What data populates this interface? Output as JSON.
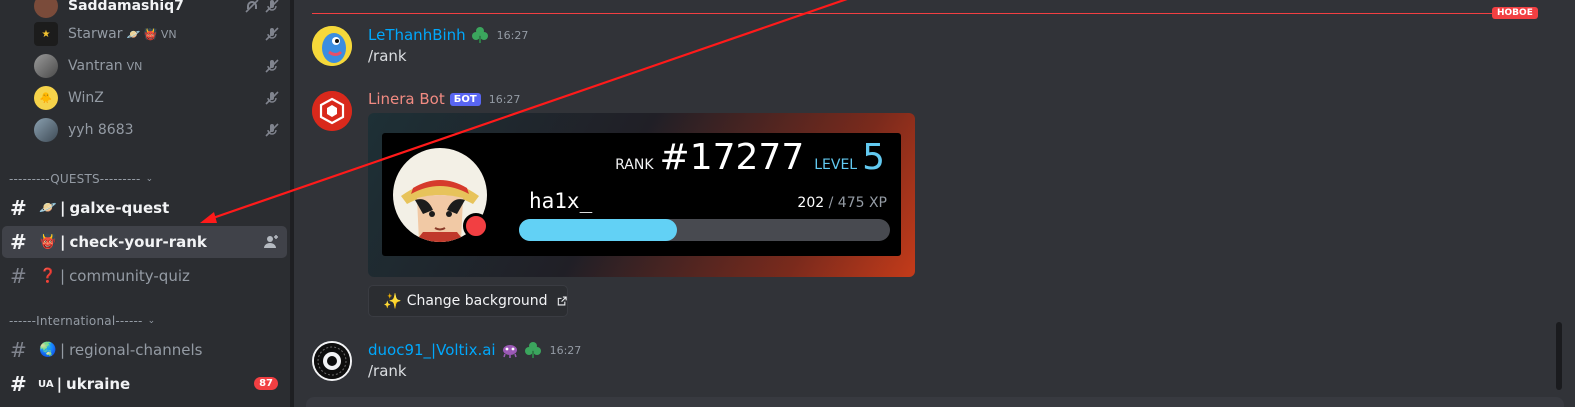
{
  "sidebar": {
    "members": [
      {
        "name": "Saddamashiq7",
        "deco": "",
        "bright": true
      },
      {
        "name": "Starwar",
        "deco": "🪐 👹 VN",
        "bright": false
      },
      {
        "name": "Vantran",
        "deco": "VN",
        "bright": false
      },
      {
        "name": "WinZ",
        "deco": "",
        "bright": false
      },
      {
        "name": "yyh 8683",
        "deco": "",
        "bright": false
      }
    ],
    "categories": [
      {
        "label": "---------QUESTS---------"
      },
      {
        "label": "------International------"
      }
    ],
    "channels": [
      {
        "emoji": "🪐",
        "bar": "|",
        "name": "galxe-quest"
      },
      {
        "emoji": "👹",
        "bar": "|",
        "name": "check-your-rank"
      },
      {
        "emoji": "❓",
        "bar": "|",
        "name": "community-quiz"
      },
      {
        "emoji": "🌏",
        "bar": "|",
        "name": "regional-channels"
      },
      {
        "emoji": "UA",
        "bar": "|",
        "name": "ukraine",
        "badge": "87"
      }
    ]
  },
  "chat": {
    "new_marker": "НОВОЕ",
    "messages": [
      {
        "author": "LeThanhBinh",
        "author_color": "#00a8fc",
        "time": "16:27",
        "text": "/rank"
      },
      {
        "author": "Linera Bot",
        "author_color": "#f28b82",
        "tag": "БОТ",
        "time": "16:27"
      },
      {
        "author": "duoc91_|Voltix.ai",
        "author_color": "#00a8fc",
        "time": "16:27",
        "text": "/rank"
      }
    ],
    "rank_card": {
      "rank_label": "RANK",
      "rank_value": "#17277",
      "level_label": "LEVEL",
      "level_value": "5",
      "username": "ha1x_",
      "xp_current": "202",
      "xp_sep": "/",
      "xp_max": "475 XP",
      "xp_fraction": 0.4253
    },
    "change_bg_button": "Change background"
  },
  "colors": {
    "accent_red": "#f23f42",
    "bot_tag": "#5865f2",
    "level_blue": "#62c9f0",
    "xp_bar": "#62d1f5"
  }
}
